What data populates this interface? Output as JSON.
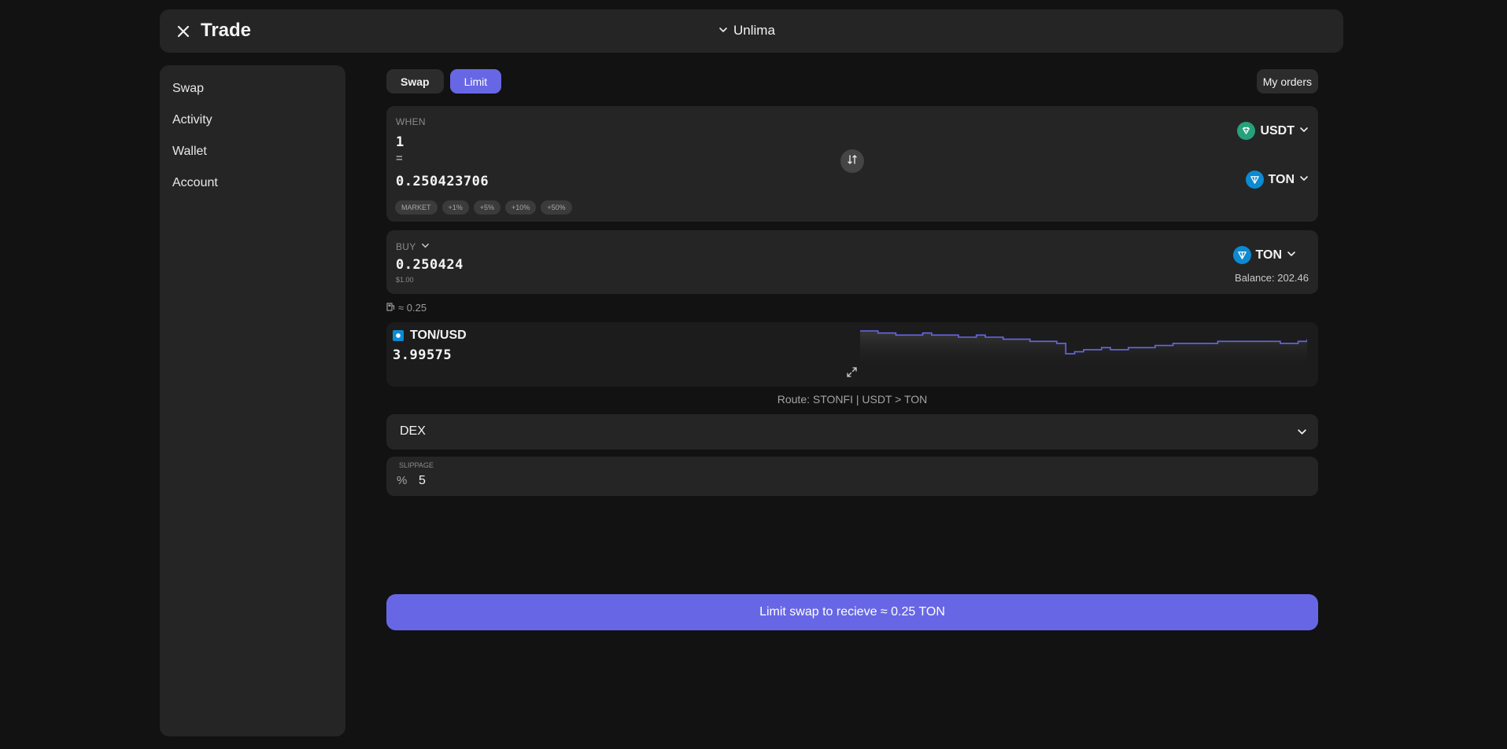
{
  "header": {
    "title": "Trade",
    "account": "Unlima"
  },
  "sidebar": {
    "items": [
      {
        "label": "Swap"
      },
      {
        "label": "Activity"
      },
      {
        "label": "Wallet"
      },
      {
        "label": "Account"
      }
    ]
  },
  "tabs": [
    {
      "label": "Swap",
      "active": false
    },
    {
      "label": "Limit",
      "active": true
    }
  ],
  "my_orders_label": "My orders",
  "when_card": {
    "label": "WHEN",
    "amount": "1",
    "equals": "=",
    "price": "0.250423706",
    "from_token": "USDT",
    "to_token": "TON",
    "chips": [
      "MARKET",
      "+1%",
      "+5%",
      "+10%",
      "+50%"
    ]
  },
  "buy_card": {
    "label": "BUY",
    "amount": "0.250424",
    "usd_value": "$1.00",
    "token": "TON",
    "balance": "Balance: 202.46"
  },
  "rate_line": "≈ 0.25",
  "chart": {
    "pair": "TON/USD",
    "price": "3.99575",
    "line_color": "#6767e6"
  },
  "chart_data": {
    "type": "line",
    "x": [
      0,
      1,
      2,
      3,
      4,
      5,
      6,
      7,
      8,
      9,
      10,
      11,
      12,
      13,
      14,
      15,
      16,
      17,
      18,
      19,
      20,
      21,
      22,
      23,
      24,
      25,
      26,
      27,
      28,
      29,
      30,
      31,
      32,
      33,
      34,
      35,
      36,
      37,
      38,
      39,
      40,
      41,
      42,
      43,
      44,
      45,
      46,
      47,
      48,
      49,
      50
    ],
    "values": [
      4.03,
      4.03,
      4.02,
      4.02,
      4.01,
      4.01,
      4.01,
      4.02,
      4.01,
      4.01,
      4.01,
      4.0,
      4.0,
      4.01,
      4.0,
      4.0,
      3.99,
      3.99,
      3.99,
      3.98,
      3.98,
      3.98,
      3.97,
      3.92,
      3.93,
      3.94,
      3.94,
      3.95,
      3.94,
      3.94,
      3.95,
      3.95,
      3.95,
      3.96,
      3.96,
      3.97,
      3.97,
      3.97,
      3.97,
      3.97,
      3.98,
      3.98,
      3.98,
      3.98,
      3.98,
      3.98,
      3.98,
      3.97,
      3.97,
      3.98,
      3.99
    ],
    "title": "TON/USD"
  },
  "route": "Route: STONFI | USDT > TON",
  "dex": {
    "label": "DEX"
  },
  "slippage": {
    "label": "SLIPPAGE",
    "unit": "%",
    "value": "5"
  },
  "cta_label": "Limit swap to recieve ≈ 0.25 TON"
}
